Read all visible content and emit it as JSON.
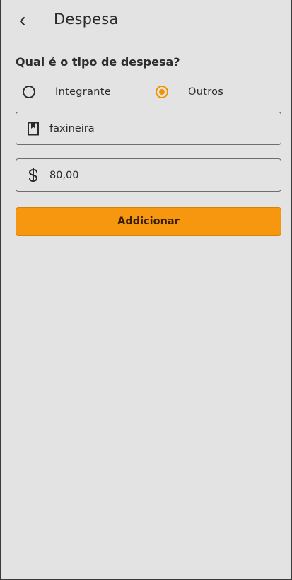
{
  "header": {
    "title": "Despesa",
    "back_icon": "chevron-left-icon"
  },
  "form": {
    "question": "Qual é o tipo de despesa?",
    "expense_type": {
      "options": [
        {
          "label": "Integrante",
          "selected": false
        },
        {
          "label": "Outros",
          "selected": true
        }
      ]
    },
    "description": {
      "icon": "bookmark-icon",
      "value": "faxineira"
    },
    "amount": {
      "icon": "dollar-icon",
      "value": "80,00"
    },
    "submit_label": "Addicionar"
  },
  "colors": {
    "background": "#e3e3e3",
    "accent": "#f7970f",
    "text": "#2a2a2a"
  }
}
